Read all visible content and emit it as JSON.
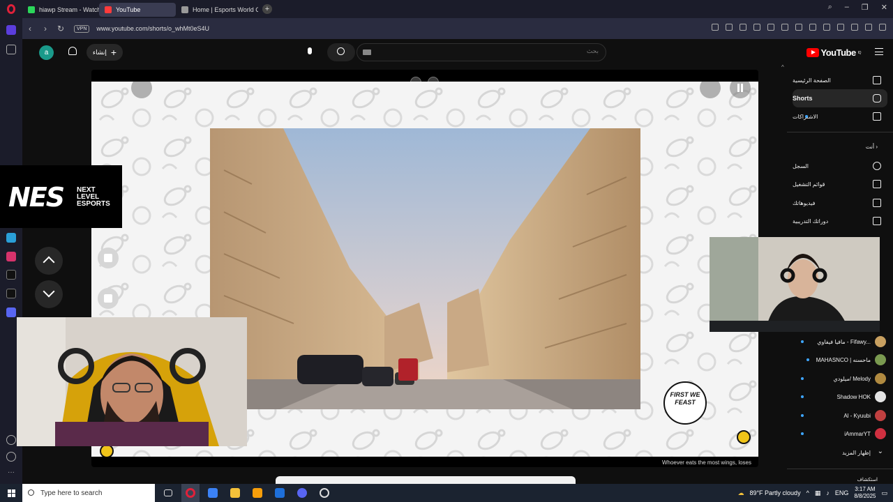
{
  "browser": {
    "tabs": [
      {
        "label": "hiawp Stream - Watch Liv",
        "color": "#2bd65a",
        "active": false
      },
      {
        "label": "YouTube",
        "color": "#ff3b3b",
        "active": true
      },
      {
        "label": "Home | Esports World Cup",
        "color": "#999999",
        "active": false
      }
    ],
    "vpn": "VPN",
    "url": "www.youtube.com/shorts/o_whMt0eS4U"
  },
  "yt": {
    "logo": "YouTube",
    "logo_sup": "IQ",
    "search_placeholder": "بحث",
    "create_label": "إنشاء",
    "avatar_letter": "a"
  },
  "guide": {
    "items": [
      {
        "label": "الصفحة الرئيسية",
        "active": false
      },
      {
        "label": "Shorts",
        "active": true
      },
      {
        "label": "الاشتراكات",
        "active": false
      }
    ],
    "you_label": "أنت",
    "you_items": [
      "السجل",
      "قوائم التشغيل",
      "فيديوهاتك",
      "دوراتك التدريبية"
    ],
    "subscriptions": [
      {
        "label": "مافيا فيفاوي - Fifawy...",
        "color": "#c8a060"
      },
      {
        "label": "MAHASNCO | ماحسنه",
        "color": "#7a9a50"
      },
      {
        "label": "ميلودي/ Melody",
        "color": "#b08a40"
      },
      {
        "label": "Shadow HOK",
        "color": "#e4e4e4"
      },
      {
        "label": "Al - Kyuubi",
        "color": "#c04040"
      },
      {
        "label": "iAmmarYT",
        "color": "#d03040"
      }
    ],
    "show_more": "إظهار المزيد",
    "bottom_label": "استكشاف"
  },
  "player": {
    "caption": "Whoever eats the most wings, loses",
    "feast_text": "FIRST WE FEAST"
  },
  "overlay": {
    "nes_big": "NES",
    "nes_small_1": "NEXT",
    "nes_small_2": "LEVEL",
    "nes_small_3": "ESPORTS"
  },
  "taskbar": {
    "search_placeholder": "Type here to search",
    "weather": "89°F  Partly cloudy",
    "lang": "ENG",
    "time": "3:17 AM",
    "date": "8/8/2025"
  }
}
